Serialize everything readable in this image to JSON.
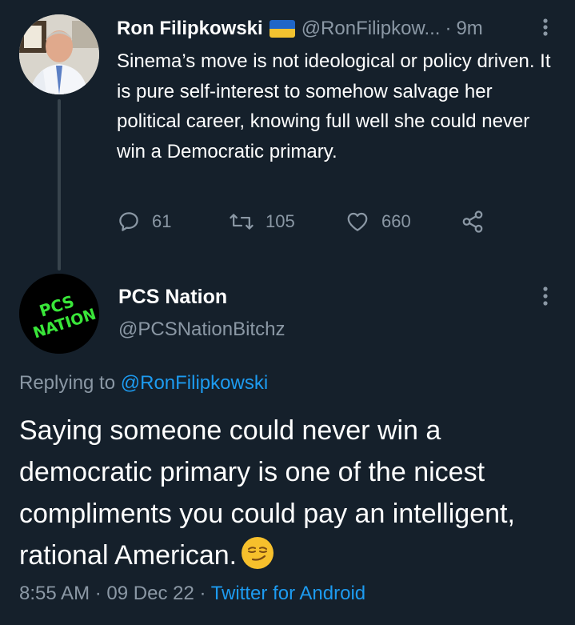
{
  "tweet1": {
    "name": "Ron Filipkowski",
    "flag_icon": "ukraine-flag-icon",
    "handle": "@RonFilipkow...",
    "separator": "·",
    "time": "9m",
    "text": "Sinema’s move is not ideological or policy driven. It is pure self-interest to somehow salvage her political career, knowing full well she could never win a Democratic primary.",
    "replies": "61",
    "retweets": "105",
    "likes": "660",
    "icons": [
      "reply-icon",
      "retweet-icon",
      "like-icon",
      "share-icon",
      "more-icon"
    ]
  },
  "tweet2": {
    "name": "PCS Nation",
    "handle": "@PCSNationBitchz",
    "avatar_text_line1": "PCS",
    "avatar_text_line2": "NATION",
    "replying_prefix": "Replying to",
    "replying_to": "@RonFilipkowski",
    "text": "Saying someone could never win a democratic primary is one of the nicest compliments you could pay an intelligent, rational American.",
    "emoji": "smirking-face-emoji",
    "time": "8:55 AM",
    "date": "09 Dec 22",
    "separator": "·",
    "source": "Twitter for Android"
  },
  "colors": {
    "background": "#15202b",
    "secondary_text": "#8b98a5",
    "link": "#1d9bf0",
    "avatar_lettering": "#39e639"
  }
}
